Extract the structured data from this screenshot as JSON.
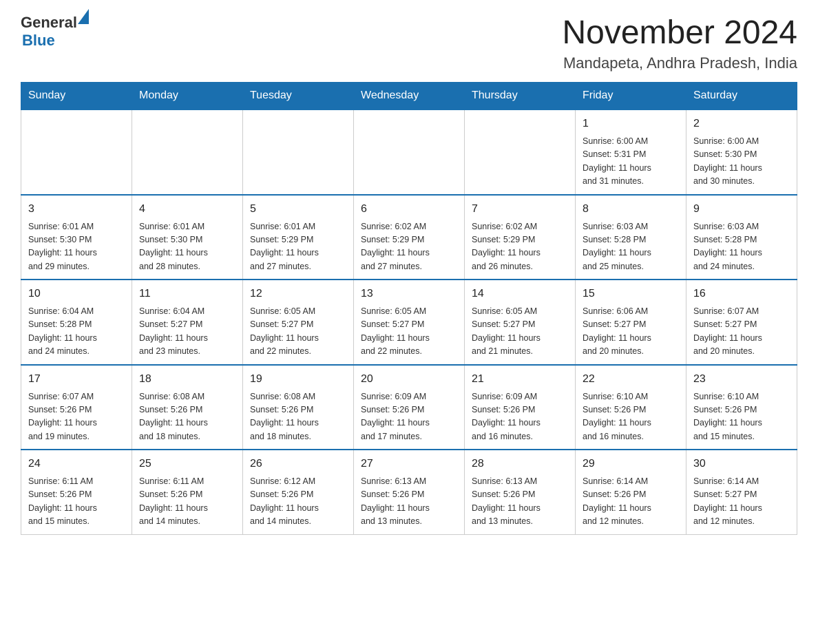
{
  "header": {
    "logo": {
      "general": "General",
      "blue": "Blue",
      "triangle_aria": "triangle icon"
    },
    "title": "November 2024",
    "location": "Mandapeta, Andhra Pradesh, India"
  },
  "calendar": {
    "days_of_week": [
      "Sunday",
      "Monday",
      "Tuesday",
      "Wednesday",
      "Thursday",
      "Friday",
      "Saturday"
    ],
    "weeks": [
      [
        {
          "date": "",
          "info": ""
        },
        {
          "date": "",
          "info": ""
        },
        {
          "date": "",
          "info": ""
        },
        {
          "date": "",
          "info": ""
        },
        {
          "date": "",
          "info": ""
        },
        {
          "date": "1",
          "info": "Sunrise: 6:00 AM\nSunset: 5:31 PM\nDaylight: 11 hours\nand 31 minutes."
        },
        {
          "date": "2",
          "info": "Sunrise: 6:00 AM\nSunset: 5:30 PM\nDaylight: 11 hours\nand 30 minutes."
        }
      ],
      [
        {
          "date": "3",
          "info": "Sunrise: 6:01 AM\nSunset: 5:30 PM\nDaylight: 11 hours\nand 29 minutes."
        },
        {
          "date": "4",
          "info": "Sunrise: 6:01 AM\nSunset: 5:30 PM\nDaylight: 11 hours\nand 28 minutes."
        },
        {
          "date": "5",
          "info": "Sunrise: 6:01 AM\nSunset: 5:29 PM\nDaylight: 11 hours\nand 27 minutes."
        },
        {
          "date": "6",
          "info": "Sunrise: 6:02 AM\nSunset: 5:29 PM\nDaylight: 11 hours\nand 27 minutes."
        },
        {
          "date": "7",
          "info": "Sunrise: 6:02 AM\nSunset: 5:29 PM\nDaylight: 11 hours\nand 26 minutes."
        },
        {
          "date": "8",
          "info": "Sunrise: 6:03 AM\nSunset: 5:28 PM\nDaylight: 11 hours\nand 25 minutes."
        },
        {
          "date": "9",
          "info": "Sunrise: 6:03 AM\nSunset: 5:28 PM\nDaylight: 11 hours\nand 24 minutes."
        }
      ],
      [
        {
          "date": "10",
          "info": "Sunrise: 6:04 AM\nSunset: 5:28 PM\nDaylight: 11 hours\nand 24 minutes."
        },
        {
          "date": "11",
          "info": "Sunrise: 6:04 AM\nSunset: 5:27 PM\nDaylight: 11 hours\nand 23 minutes."
        },
        {
          "date": "12",
          "info": "Sunrise: 6:05 AM\nSunset: 5:27 PM\nDaylight: 11 hours\nand 22 minutes."
        },
        {
          "date": "13",
          "info": "Sunrise: 6:05 AM\nSunset: 5:27 PM\nDaylight: 11 hours\nand 22 minutes."
        },
        {
          "date": "14",
          "info": "Sunrise: 6:05 AM\nSunset: 5:27 PM\nDaylight: 11 hours\nand 21 minutes."
        },
        {
          "date": "15",
          "info": "Sunrise: 6:06 AM\nSunset: 5:27 PM\nDaylight: 11 hours\nand 20 minutes."
        },
        {
          "date": "16",
          "info": "Sunrise: 6:07 AM\nSunset: 5:27 PM\nDaylight: 11 hours\nand 20 minutes."
        }
      ],
      [
        {
          "date": "17",
          "info": "Sunrise: 6:07 AM\nSunset: 5:26 PM\nDaylight: 11 hours\nand 19 minutes."
        },
        {
          "date": "18",
          "info": "Sunrise: 6:08 AM\nSunset: 5:26 PM\nDaylight: 11 hours\nand 18 minutes."
        },
        {
          "date": "19",
          "info": "Sunrise: 6:08 AM\nSunset: 5:26 PM\nDaylight: 11 hours\nand 18 minutes."
        },
        {
          "date": "20",
          "info": "Sunrise: 6:09 AM\nSunset: 5:26 PM\nDaylight: 11 hours\nand 17 minutes."
        },
        {
          "date": "21",
          "info": "Sunrise: 6:09 AM\nSunset: 5:26 PM\nDaylight: 11 hours\nand 16 minutes."
        },
        {
          "date": "22",
          "info": "Sunrise: 6:10 AM\nSunset: 5:26 PM\nDaylight: 11 hours\nand 16 minutes."
        },
        {
          "date": "23",
          "info": "Sunrise: 6:10 AM\nSunset: 5:26 PM\nDaylight: 11 hours\nand 15 minutes."
        }
      ],
      [
        {
          "date": "24",
          "info": "Sunrise: 6:11 AM\nSunset: 5:26 PM\nDaylight: 11 hours\nand 15 minutes."
        },
        {
          "date": "25",
          "info": "Sunrise: 6:11 AM\nSunset: 5:26 PM\nDaylight: 11 hours\nand 14 minutes."
        },
        {
          "date": "26",
          "info": "Sunrise: 6:12 AM\nSunset: 5:26 PM\nDaylight: 11 hours\nand 14 minutes."
        },
        {
          "date": "27",
          "info": "Sunrise: 6:13 AM\nSunset: 5:26 PM\nDaylight: 11 hours\nand 13 minutes."
        },
        {
          "date": "28",
          "info": "Sunrise: 6:13 AM\nSunset: 5:26 PM\nDaylight: 11 hours\nand 13 minutes."
        },
        {
          "date": "29",
          "info": "Sunrise: 6:14 AM\nSunset: 5:26 PM\nDaylight: 11 hours\nand 12 minutes."
        },
        {
          "date": "30",
          "info": "Sunrise: 6:14 AM\nSunset: 5:27 PM\nDaylight: 11 hours\nand 12 minutes."
        }
      ]
    ]
  }
}
